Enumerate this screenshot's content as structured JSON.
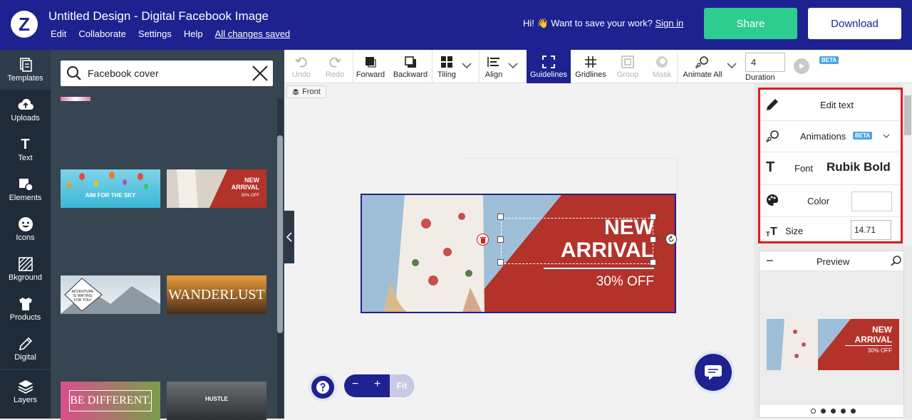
{
  "header": {
    "title": "Untitled Design - Digital Facebook Image",
    "menu": [
      "Edit",
      "Collaborate",
      "Settings",
      "Help"
    ],
    "saved_status": "All changes saved",
    "save_prompt": "Hi! 👋 Want to save your work?",
    "sign_in": "Sign in",
    "share_label": "Share",
    "download_label": "Download",
    "logo_letter": "Z"
  },
  "left_nav": [
    {
      "label": "Templates",
      "icon": "templates-icon"
    },
    {
      "label": "Uploads",
      "icon": "upload-cloud-icon"
    },
    {
      "label": "Text",
      "icon": "text-icon"
    },
    {
      "label": "Elements",
      "icon": "elements-icon"
    },
    {
      "label": "Icons",
      "icon": "smiley-icon"
    },
    {
      "label": "Bkground",
      "icon": "background-icon"
    },
    {
      "label": "Products",
      "icon": "tshirt-icon"
    },
    {
      "label": "Digital",
      "icon": "pen-icon"
    },
    {
      "label": "Layers",
      "icon": "layers-icon"
    }
  ],
  "templates_panel": {
    "search_value": "Facebook cover",
    "thumbnails": [
      {
        "text": "AIM FOR THE SKY"
      },
      {
        "text": "NEW ARRIVAL",
        "sub": "30% OFF"
      },
      {
        "text": "ADVENTURE IS WAITING FOR YOU!"
      },
      {
        "text": "WANDERLUST"
      },
      {
        "text": "BE DIFFERENT."
      },
      {
        "text": "HUSTLE"
      }
    ]
  },
  "toolbar": {
    "tools": [
      {
        "label": "Undo",
        "icon": "undo-icon",
        "disabled": true
      },
      {
        "label": "Redo",
        "icon": "redo-icon",
        "disabled": true
      },
      {
        "label": "Forward",
        "icon": "bring-forward-icon"
      },
      {
        "label": "Backward",
        "icon": "send-backward-icon"
      },
      {
        "label": "Tiling",
        "icon": "tiling-icon"
      },
      {
        "label": "Align",
        "icon": "align-icon"
      },
      {
        "label": "Guidelines",
        "icon": "guidelines-icon",
        "active": true
      },
      {
        "label": "Gridlines",
        "icon": "gridlines-icon"
      },
      {
        "label": "Group",
        "icon": "group-icon",
        "disabled": true
      },
      {
        "label": "Mask",
        "icon": "mask-icon",
        "disabled": true
      },
      {
        "label": "Animate All",
        "icon": "animate-icon"
      }
    ],
    "duration_value": "4",
    "duration_label": "Duration",
    "beta_badge": "BETA"
  },
  "canvas": {
    "front_label": "Front",
    "headline_line1": "NEW",
    "headline_line2": "ARRIVAL",
    "discount": "30% OFF"
  },
  "properties": {
    "edit_text": "Edit text",
    "animations": "Animations",
    "beta_badge": "BETA",
    "font_label": "Font",
    "font_value": "Rubik Bold",
    "color_label": "Color",
    "size_label": "Size",
    "size_value": "14.71"
  },
  "preview": {
    "title": "Preview",
    "headline_line1": "NEW",
    "headline_line2": "ARRIVAL",
    "discount": "30% OFF",
    "page_count": 5,
    "current_page": 1
  },
  "zoom": {
    "fit_label": "Fit",
    "minus": "−",
    "plus": "+"
  },
  "colors": {
    "brand_navy": "#1d2290",
    "share_green": "#2ecc8f",
    "banner_red": "#b3322a",
    "highlight_red": "#e01b1b",
    "beta_blue": "#4aa5e6"
  }
}
